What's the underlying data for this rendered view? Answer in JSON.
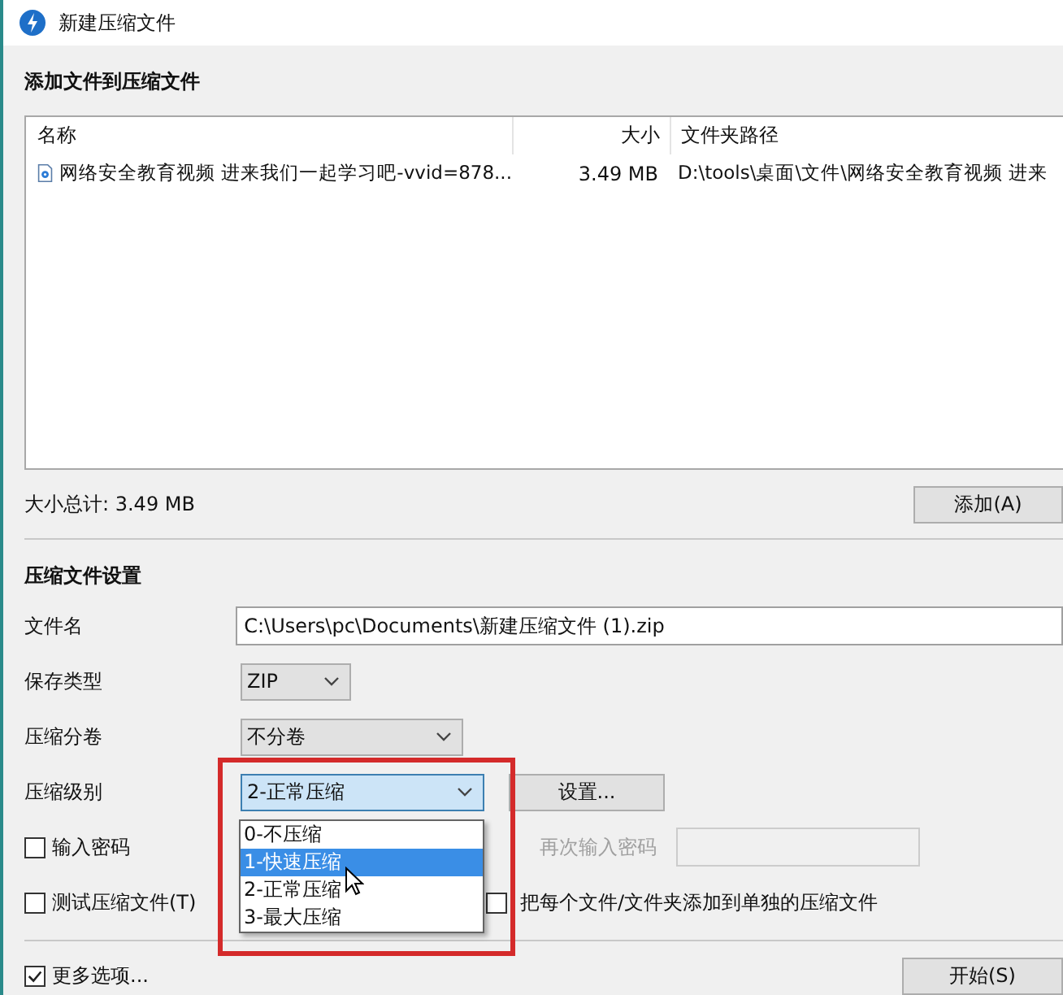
{
  "window": {
    "title": "新建压缩文件"
  },
  "files_section": {
    "title": "添加文件到压缩文件",
    "columns": [
      "名称",
      "大小",
      "文件夹路径"
    ],
    "rows": [
      {
        "name": "网络安全教育视频 进来我们一起学习吧-vvid=878...",
        "size": "3.49 MB",
        "path": "D:\\tools\\桌面\\文件\\网络安全教育视频 进来"
      }
    ],
    "total": "大小总计: 3.49 MB",
    "add_button": "添加(A)"
  },
  "settings": {
    "title": "压缩文件设置",
    "filename_label": "文件名",
    "filename": "C:\\Users\\pc\\Documents\\新建压缩文件 (1).zip",
    "type_label": "保存类型",
    "type": "ZIP",
    "split_label": "压缩分卷",
    "split": "不分卷",
    "level_label": "压缩级别",
    "level": "2-正常压缩",
    "level_options": [
      {
        "label": "0-不压缩",
        "selected": false
      },
      {
        "label": "1-快速压缩",
        "selected": true
      },
      {
        "label": "2-正常压缩",
        "selected": false
      },
      {
        "label": "3-最大压缩",
        "selected": false
      }
    ],
    "settings_button": "设置...",
    "password": {
      "label": "输入密码",
      "checked": false
    },
    "confirm": {
      "label": "再次输入密码",
      "disabled": true
    },
    "test": {
      "label": "测试压缩文件(T)",
      "checked": false
    },
    "separate": {
      "label": "把每个文件/文件夹添加到单独的压缩文件",
      "checked": false
    }
  },
  "more_options": {
    "label": "更多选项...",
    "checked": true
  },
  "start_button": "开始(S)"
}
